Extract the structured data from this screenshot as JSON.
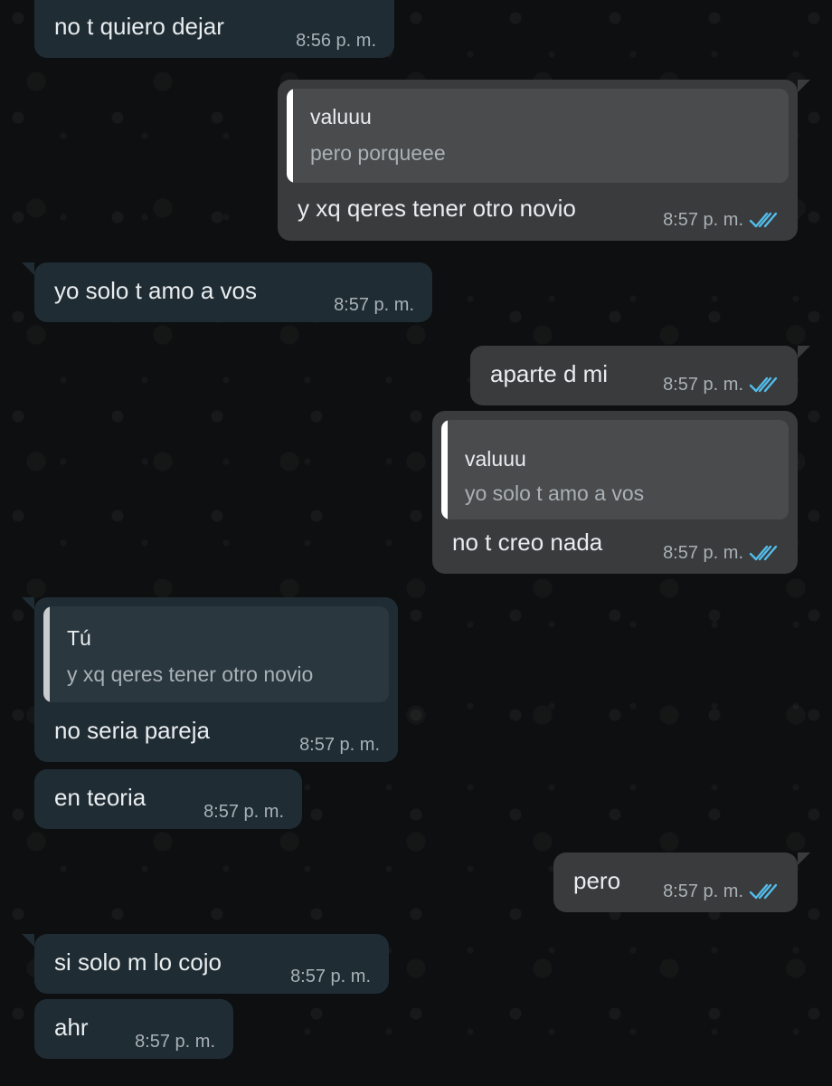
{
  "messages": [
    {
      "direction": "incoming",
      "text": "no t quiero dejar",
      "time": "8:56 p. m."
    },
    {
      "direction": "outgoing",
      "quote": {
        "author": "valuuu",
        "text": "pero porqueee"
      },
      "text": "y xq qeres tener otro novio",
      "time": "8:57 p. m.",
      "status": "read",
      "status_icon": "double-check-icon"
    },
    {
      "direction": "incoming",
      "text": "yo solo t amo a vos",
      "time": "8:57 p. m."
    },
    {
      "direction": "outgoing",
      "text": "aparte d mi",
      "time": "8:57 p. m.",
      "status": "read",
      "status_icon": "double-check-icon"
    },
    {
      "direction": "outgoing",
      "quote": {
        "author": "valuuu",
        "text": "yo solo t amo a vos"
      },
      "text": "no t creo nada",
      "time": "8:57 p. m.",
      "status": "read",
      "status_icon": "double-check-icon"
    },
    {
      "direction": "incoming",
      "quote": {
        "author": "Tú",
        "text": "y xq qeres tener otro novio"
      },
      "text": "no seria pareja",
      "time": "8:57 p. m."
    },
    {
      "direction": "incoming",
      "text": "en teoria",
      "time": "8:57 p. m."
    },
    {
      "direction": "outgoing",
      "text": "pero",
      "time": "8:57 p. m.",
      "status": "read",
      "status_icon": "double-check-icon"
    },
    {
      "direction": "incoming",
      "text": "si solo m lo cojo",
      "time": "8:57 p. m."
    },
    {
      "direction": "incoming",
      "text": "ahr",
      "time": "8:57 p. m."
    }
  ],
  "colors": {
    "background": "#0d0f10",
    "incoming_bubble": "#1f2c34",
    "outgoing_bubble": "#3a3b3c",
    "read_check": "#53bdeb"
  }
}
